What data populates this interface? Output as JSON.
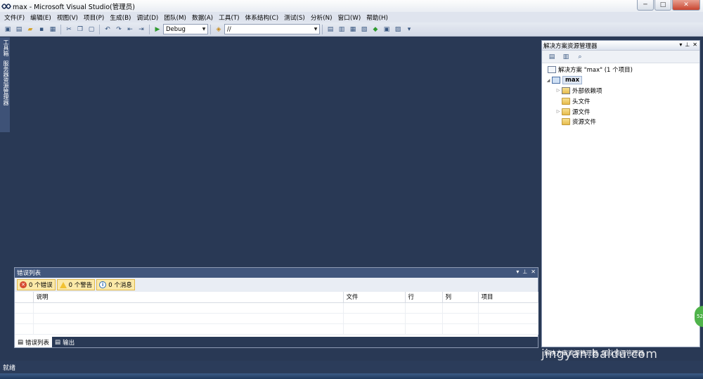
{
  "window": {
    "title": "max - Microsoft Visual Studio(管理员)",
    "min_symbol": "─",
    "max_symbol": "□",
    "close_symbol": "✕"
  },
  "menu": [
    "文件(F)",
    "编辑(E)",
    "视图(V)",
    "项目(P)",
    "生成(B)",
    "调试(D)",
    "团队(M)",
    "数据(A)",
    "工具(T)",
    "体系结构(C)",
    "测试(S)",
    "分析(N)",
    "窗口(W)",
    "帮助(H)"
  ],
  "toolbar": {
    "config_value": "Debug",
    "find_value": "//",
    "start_icon": "play-icon"
  },
  "left_tabs": [
    "工具箱",
    "服务器资源管理器"
  ],
  "solution_explorer": {
    "title": "解决方案资源管理器",
    "solution_label": "解决方案 \"max\" (1 个项目)",
    "project": "max",
    "items": [
      "外部依赖项",
      "头文件",
      "源文件",
      "资源文件"
    ],
    "expandable": [
      true,
      false,
      true,
      false
    ]
  },
  "error_list": {
    "title": "错误列表",
    "errors_label": "0 个错误",
    "warnings_label": "0 个警告",
    "messages_label": "0 个消息",
    "columns": [
      "说明",
      "文件",
      "行",
      "列",
      "项目"
    ],
    "tabs": [
      "错误列表",
      "输出"
    ]
  },
  "bottom_right_tabs": [
    "解决方案资源管理器",
    "团队资源管理器"
  ],
  "status": "就绪",
  "watermark": "jingyan.baidu.com",
  "green_badge": "52"
}
